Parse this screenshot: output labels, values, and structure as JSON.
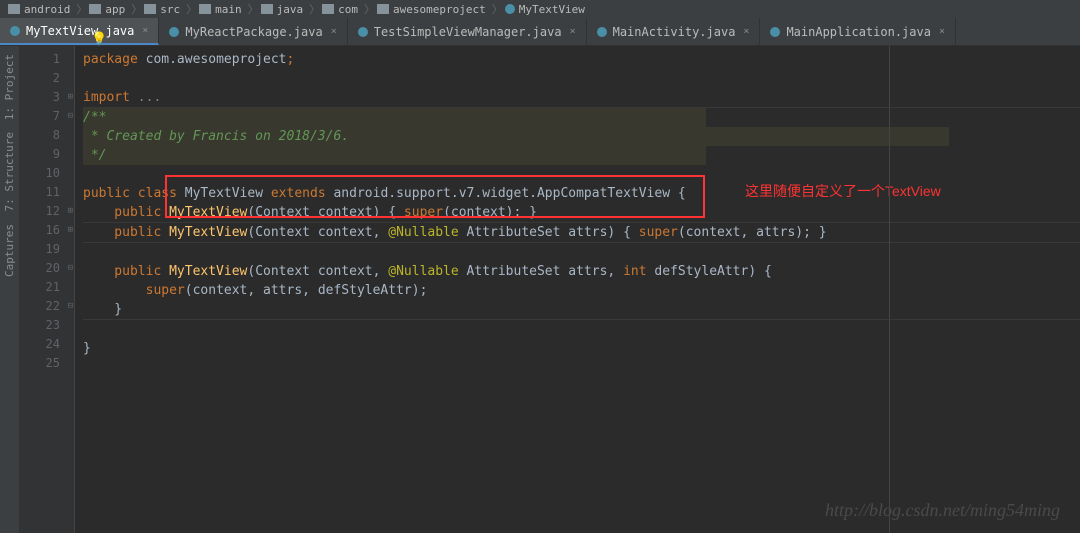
{
  "breadcrumb": {
    "items": [
      "android",
      "app",
      "src",
      "main",
      "java",
      "com",
      "awesomeproject",
      "MyTextView"
    ]
  },
  "tabs": [
    {
      "label": "MyTextView.java",
      "active": true
    },
    {
      "label": "MyReactPackage.java",
      "active": false
    },
    {
      "label": "TestSimpleViewManager.java",
      "active": false
    },
    {
      "label": "MainActivity.java",
      "active": false
    },
    {
      "label": "MainApplication.java",
      "active": false
    }
  ],
  "sidebar": {
    "tools": [
      "1: Project",
      "7: Structure",
      "Captures"
    ]
  },
  "gutter": {
    "lines": [
      "1",
      "2",
      "3",
      "7",
      "8",
      "9",
      "10",
      "11",
      "12",
      "16",
      "19",
      "20",
      "21",
      "22",
      "23",
      "24",
      "25"
    ]
  },
  "code": {
    "l1_package": "package",
    "l1_pkg": " com.awesomeproject",
    "l1_semi": ";",
    "l3_import": "import",
    "l3_dots": " ...",
    "l7": "/**",
    "l8": " * Created by Francis on 2018/3/6.",
    "l9": " */",
    "l11_public": "public ",
    "l11_class": "class",
    "l11_name": " MyTextView ",
    "l11_extends": "extends",
    "l11_rest": " android.support.v7.widget.AppCompatTextView {",
    "l12_public": "    public ",
    "l12_method": "MyTextView",
    "l12_params": "(Context context)",
    "l12_brace": " { ",
    "l12_super": "super",
    "l12_args": "(context); ",
    "l12_close": "}",
    "l16_public": "    public ",
    "l16_method": "MyTextView",
    "l16_p1": "(Context context, ",
    "l16_anno": "@Nullable",
    "l16_p2": " AttributeSet attrs)",
    "l16_brace": " { ",
    "l16_super": "super",
    "l16_args": "(context, attrs); ",
    "l16_close": "}",
    "l20_public": "    public ",
    "l20_method": "MyTextView",
    "l20_p1": "(Context context, ",
    "l20_anno": "@Nullable",
    "l20_p2": " AttributeSet attrs, ",
    "l20_int": "int",
    "l20_p3": " defStyleAttr) {",
    "l21_sp": "        ",
    "l21_super": "super",
    "l21_args": "(context, attrs, defStyleAttr);",
    "l22": "    }",
    "l24": "}"
  },
  "annotation": "这里随便自定义了一个TextView",
  "watermark": "http://blog.csdn.net/ming54ming"
}
